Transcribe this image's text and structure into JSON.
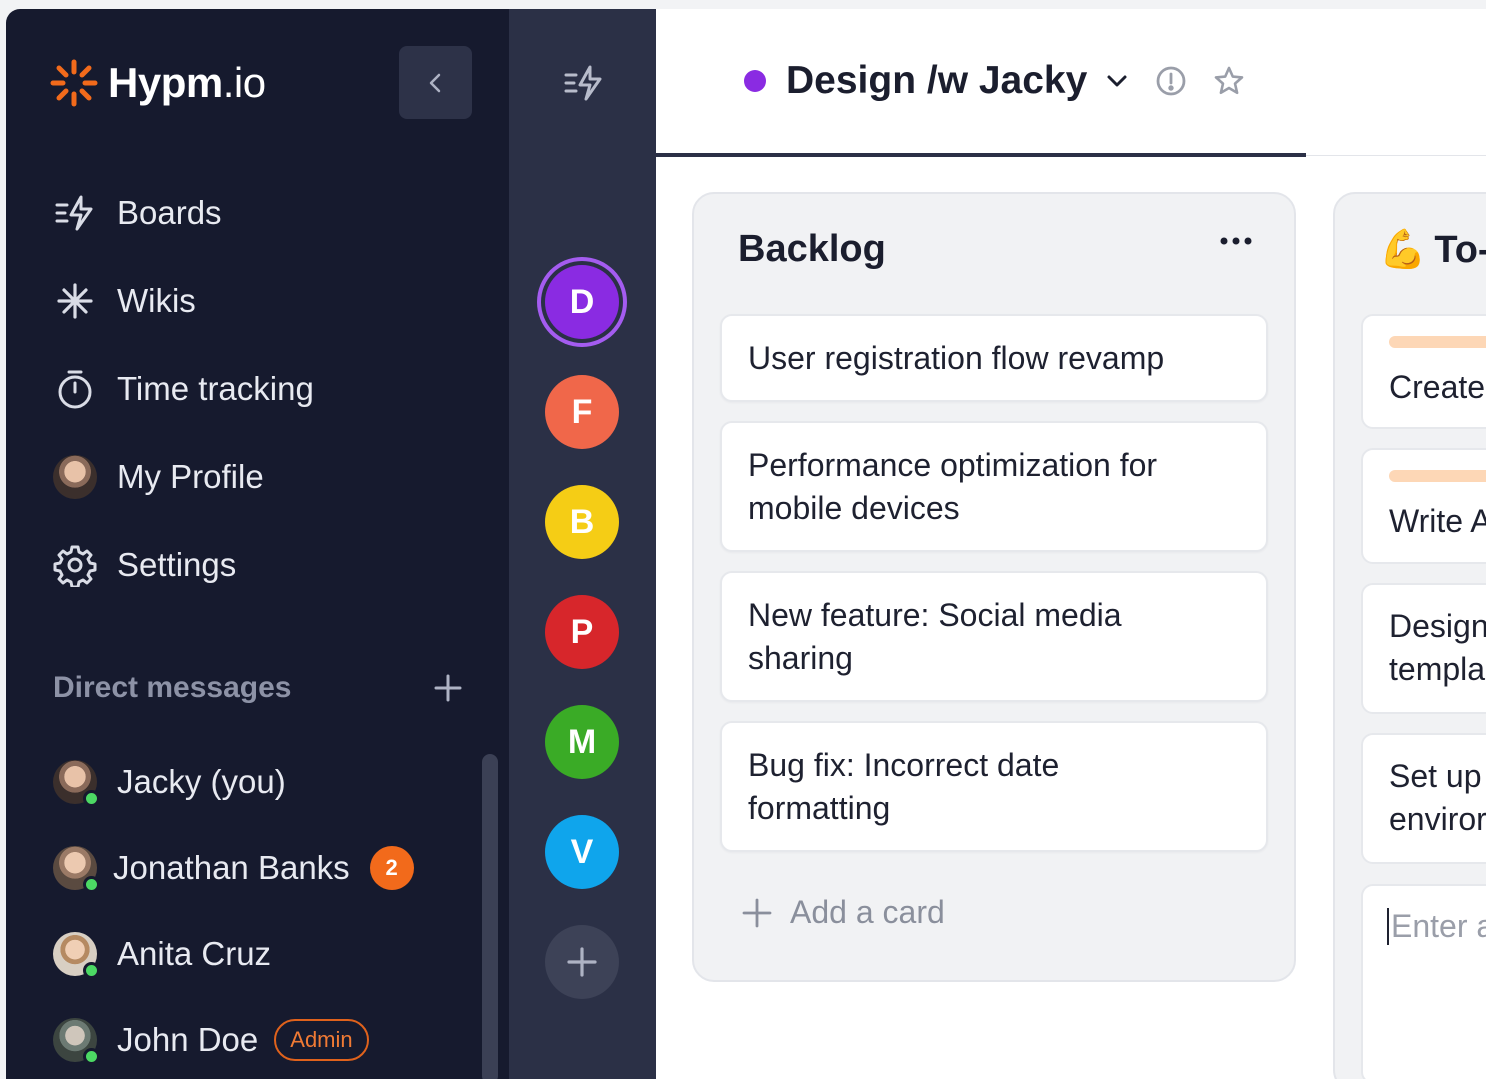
{
  "brand": {
    "name_bold": "Hypm",
    "name_thin": ".io"
  },
  "nav": {
    "items": [
      {
        "label": "Boards",
        "icon": "boards-icon"
      },
      {
        "label": "Wikis",
        "icon": "asterisk-icon"
      },
      {
        "label": "Time tracking",
        "icon": "timer-icon"
      },
      {
        "label": "My Profile",
        "icon": "avatar"
      },
      {
        "label": "Settings",
        "icon": "gear-icon"
      }
    ]
  },
  "direct_messages": {
    "title": "Direct messages",
    "items": [
      {
        "name": "Jacky (you)",
        "online": true
      },
      {
        "name": "Jonathan Banks",
        "online": true,
        "unread": "2"
      },
      {
        "name": "Anita Cruz",
        "online": true
      },
      {
        "name": "John Doe",
        "online": true,
        "badge": "Admin"
      }
    ]
  },
  "workspaces": [
    {
      "letter": "D",
      "color": "#8a2be2",
      "active": true
    },
    {
      "letter": "F",
      "color": "#f0674a"
    },
    {
      "letter": "B",
      "color": "#f5cd15"
    },
    {
      "letter": "P",
      "color": "#d7262b"
    },
    {
      "letter": "M",
      "color": "#3aab26"
    },
    {
      "letter": "V",
      "color": "#0fa5ec"
    }
  ],
  "header": {
    "title": "Design /w Jacky",
    "status_color": "#8a2be2"
  },
  "columns": {
    "backlog": {
      "title": "Backlog",
      "cards": [
        "User registration flow revamp",
        "Performance optimization for mobile devices",
        "New feature: Social media sharing",
        "Bug fix: Incorrect date formatting"
      ],
      "add_label": "Add a card"
    },
    "todo": {
      "emoji": "💪",
      "title": "To-",
      "cards": [
        "Create",
        "Write A",
        "Design\ntempla",
        "Set up\nenviror"
      ],
      "input_placeholder": "Enter a"
    }
  }
}
